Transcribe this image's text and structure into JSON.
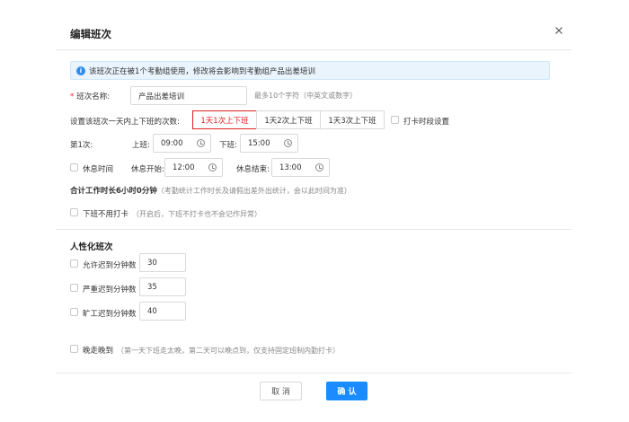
{
  "dialog": {
    "title": "编辑班次",
    "close_icon": "close-icon"
  },
  "notice": {
    "icon": "info-icon",
    "icon_glyph": "i",
    "text": "该班次正在被1个考勤组使用，修改将会影响到考勤组产品出差培训"
  },
  "shift_name": {
    "required_mark": "*",
    "label": "班次名称:",
    "value": "产品出差培训",
    "hint": "最多10个字符（中英文或数字）"
  },
  "clock_times": {
    "label": "设置该班次一天内上下班的次数:",
    "options": [
      "1天1次上下班",
      "1天2次上下班",
      "1天3次上下班"
    ],
    "selected": "1天1次上下班",
    "period_setting_label": "打卡时段设置",
    "accent_color": "#e02020"
  },
  "first": {
    "label": "第1次:",
    "on_label": "上班:",
    "on_value": "09:00",
    "off_label": "下班:",
    "off_value": "15:00"
  },
  "rest": {
    "label": "休息时间",
    "start_label": "休息开始:",
    "start_value": "12:00",
    "end_label": "休息结束:",
    "end_value": "13:00"
  },
  "total": {
    "text": "合计工作时长6小时0分钟",
    "note": "（考勤统计工作时长及请假出差外出统计，会以此时间为准）"
  },
  "no_clockout": {
    "label": "下班不用打卡",
    "note": "（开启后，下班不打卡也不会记作异常）"
  },
  "humanized": {
    "title": "人性化班次",
    "rows": [
      {
        "label": "允许迟到分钟数",
        "value": "30"
      },
      {
        "label": "严重迟到分钟数",
        "value": "35"
      },
      {
        "label": "旷工迟到分钟数",
        "value": "40"
      }
    ]
  },
  "late_leave": {
    "label": "晚走晚到",
    "note": "（第一天下班走太晚，第二天可以晚点到，仅支持固定班制内勤打卡）"
  },
  "footer": {
    "cancel_label": "取 消",
    "ok_label": "确 认",
    "primary_color": "#1a8cff"
  }
}
